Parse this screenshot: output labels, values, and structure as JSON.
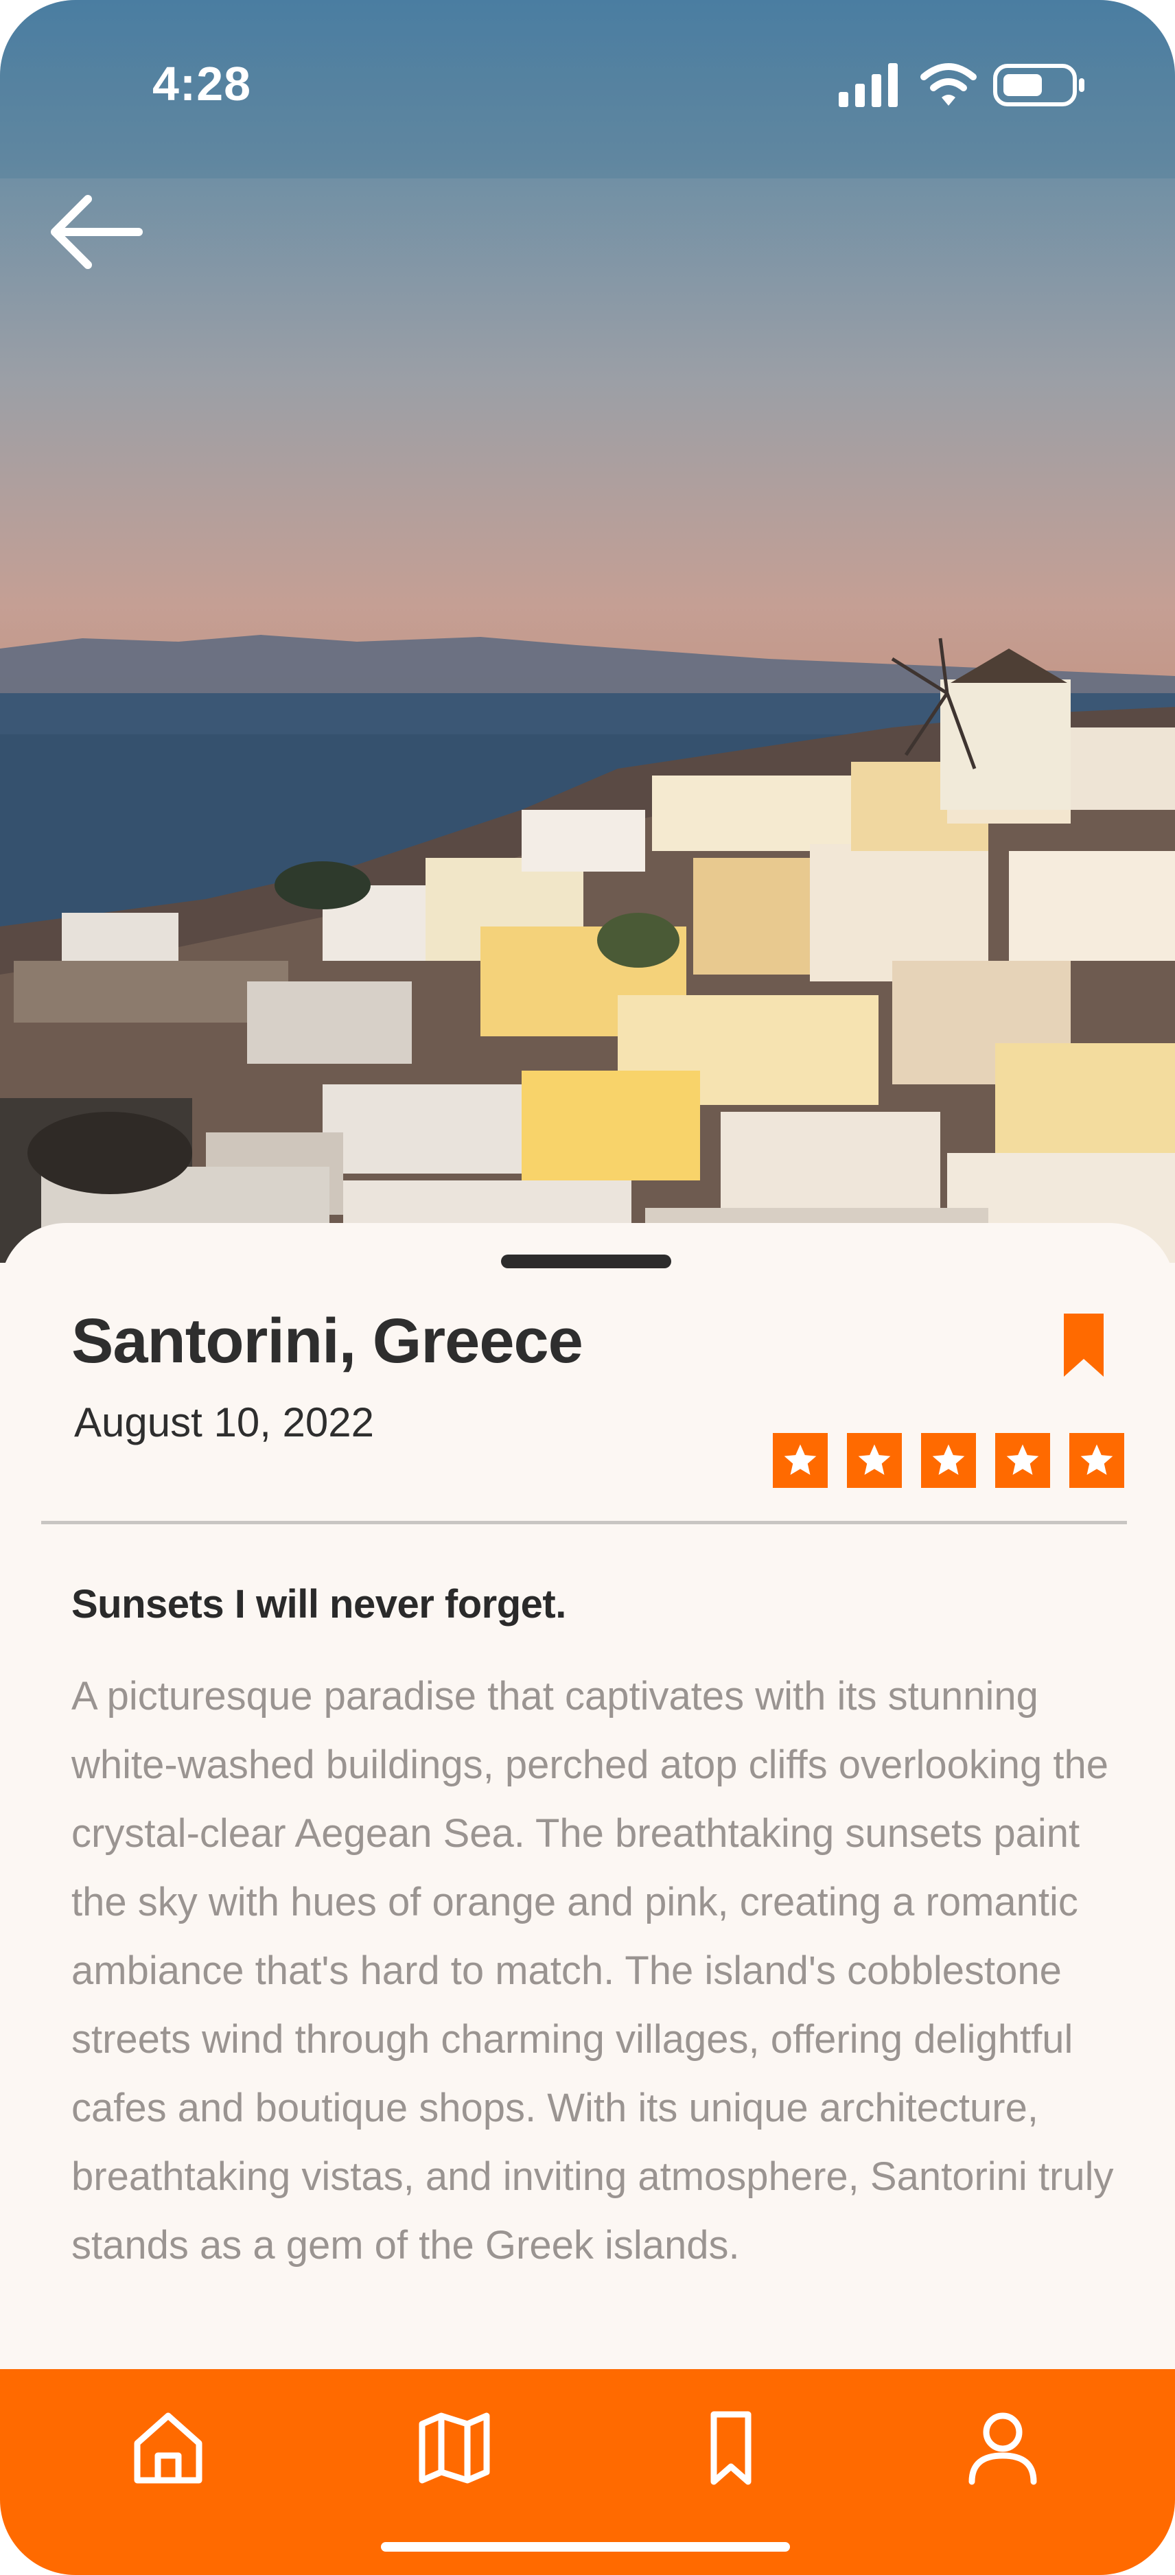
{
  "status_bar": {
    "time": "4:28",
    "icons": [
      "cellular-signal-icon",
      "wifi-icon",
      "battery-icon"
    ]
  },
  "header": {
    "back_icon": "arrow-left-icon"
  },
  "place": {
    "title": "Santorini, Greece",
    "date": "August 10, 2022",
    "rating": 5,
    "rating_max": 5,
    "bookmark_icon": "bookmark-icon"
  },
  "review": {
    "headline": "Sunsets I will never forget.",
    "body": "A picturesque paradise that captivates with its stunning white-washed buildings, perched atop cliffs overlooking the crystal-clear Aegean Sea. The breathtaking sunsets paint the sky with hues of orange and pink, creating a romantic ambiance that's hard to match. The island's cobblestone streets wind through charming villages, offering delightful cafes and boutique shops. With its unique architecture, breathtaking vistas, and inviting atmosphere, Santorini truly stands as a gem of the Greek islands."
  },
  "tabbar": {
    "tabs": [
      "home-icon",
      "map-icon",
      "bookmark-icon",
      "profile-icon"
    ]
  },
  "colors": {
    "accent": "#ff6a00",
    "sheet_background": "#fcf7f3",
    "title_text": "#2e2e2e",
    "body_text": "#9a9491"
  }
}
